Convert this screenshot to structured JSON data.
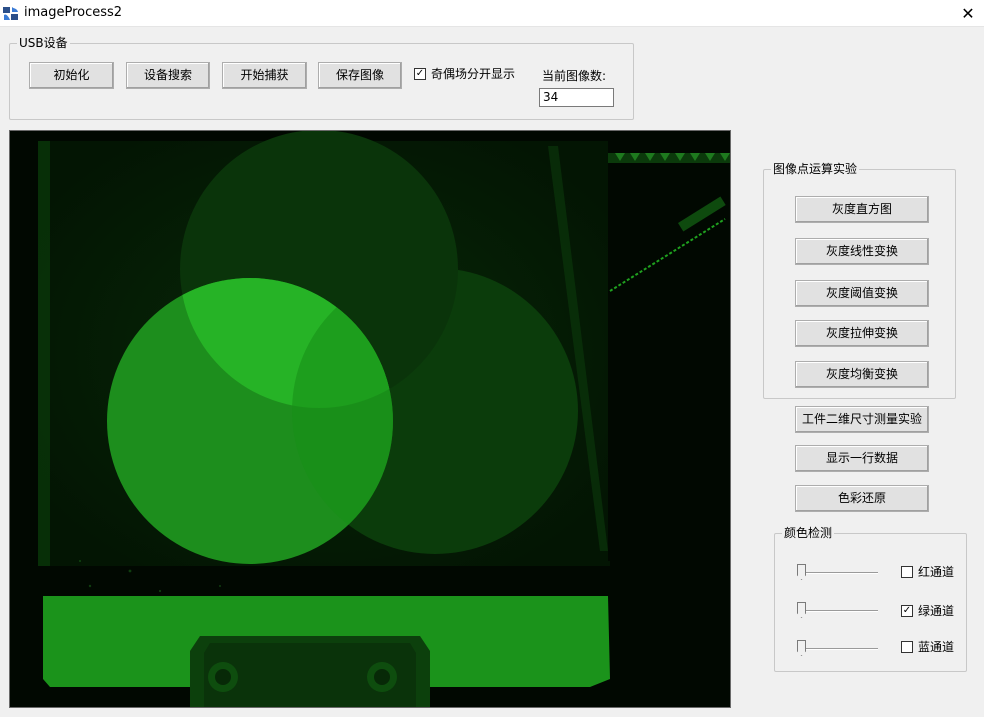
{
  "window": {
    "title": "imageProcess2",
    "close_label": "✕"
  },
  "usb_group": {
    "label": "USB设备",
    "buttons": {
      "init": "初始化",
      "search": "设备搜索",
      "capture": "开始捕获",
      "save": "保存图像"
    },
    "field_split": {
      "label": "奇偶场分开显示",
      "checked": true,
      "check_mark": "✓"
    },
    "image_count": {
      "label": "当前图像数:",
      "value": "34"
    }
  },
  "point_ops_group": {
    "label": "图像点运算实验",
    "buttons": [
      "灰度直方图",
      "灰度线性变换",
      "灰度阈值变换",
      "灰度拉伸变换",
      "灰度均衡变换"
    ]
  },
  "extra_buttons": {
    "measure": "工件二维尺寸测量实验",
    "show_row": "显示一行数据",
    "color_restore": "色彩还原"
  },
  "color_detect_group": {
    "label": "颜色检测",
    "channels": [
      {
        "label": "红通道",
        "checked": false,
        "check_mark": "",
        "slider_value": 0
      },
      {
        "label": "绿通道",
        "checked": true,
        "check_mark": "✓",
        "slider_value": 0
      },
      {
        "label": "蓝通道",
        "checked": false,
        "check_mark": "",
        "slider_value": 0
      }
    ]
  },
  "colors": {
    "image_green": "#1e9e1e",
    "image_bright": "#27c327",
    "panel_bg": "#f0f0f0"
  }
}
